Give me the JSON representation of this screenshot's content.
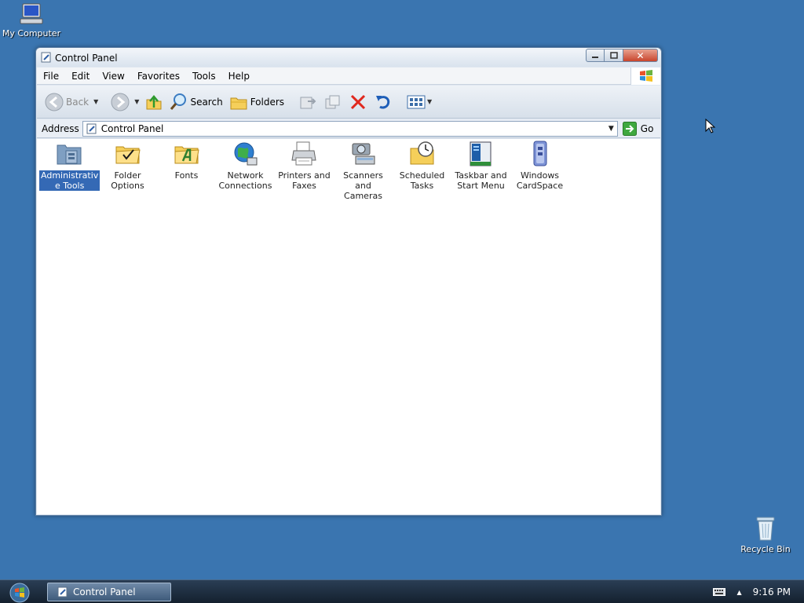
{
  "desktop": {
    "my_computer": "My Computer",
    "recycle_bin": "Recycle Bin"
  },
  "window": {
    "title": "Control Panel",
    "buttons": {
      "minimize": "▭",
      "maximize": "▢",
      "close": "✕"
    }
  },
  "menu": [
    "File",
    "Edit",
    "View",
    "Favorites",
    "Tools",
    "Help"
  ],
  "toolbar": {
    "back": "Back",
    "search": "Search",
    "folders": "Folders"
  },
  "address": {
    "label": "Address",
    "value": "Control Panel",
    "go": "Go"
  },
  "items": [
    {
      "label": "Administrative Tools",
      "line1": "Administrativ",
      "line2": "e Tools",
      "icon": "administrative-tools-icon",
      "selected": true
    },
    {
      "label": "Folder Options",
      "line1": "Folder",
      "line2": "Options",
      "icon": "folder-options-icon"
    },
    {
      "label": "Fonts",
      "line1": "Fonts",
      "line2": "",
      "icon": "fonts-icon"
    },
    {
      "label": "Network Connections",
      "line1": "Network",
      "line2": "Connections",
      "icon": "network-connections-icon"
    },
    {
      "label": "Printers and Faxes",
      "line1": "Printers and",
      "line2": "Faxes",
      "icon": "printers-icon"
    },
    {
      "label": "Scanners and Cameras",
      "line1": "Scanners and",
      "line2": "Cameras",
      "icon": "scanners-icon"
    },
    {
      "label": "Scheduled Tasks",
      "line1": "Scheduled",
      "line2": "Tasks",
      "icon": "scheduled-tasks-icon"
    },
    {
      "label": "Taskbar and Start Menu",
      "line1": "Taskbar and",
      "line2": "Start Menu",
      "icon": "taskbar-icon"
    },
    {
      "label": "Windows CardSpace",
      "line1": "Windows",
      "line2": "CardSpace",
      "icon": "cardspace-icon"
    }
  ],
  "taskbar": {
    "task": "Control Panel",
    "clock": "9:16 PM"
  },
  "colors": {
    "desktop": "#3a75b0",
    "selection": "#3469b5",
    "taskbar": "#1c2b3c"
  }
}
